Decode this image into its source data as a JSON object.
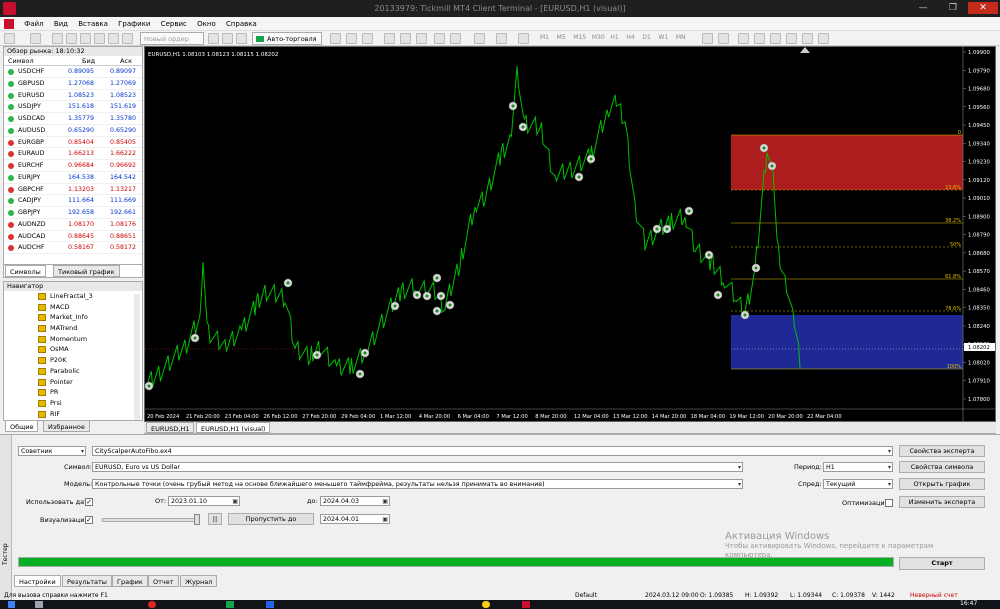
{
  "window": {
    "title": "20133979: Tickmill MT4 Client Terminal - [EURUSD,H1 (visual)]",
    "controls": [
      "—",
      "❐",
      "✕"
    ]
  },
  "menu": [
    "Файл",
    "Вид",
    "Вставка",
    "Графики",
    "Сервис",
    "Окно",
    "Справка"
  ],
  "toolbar": {
    "new_order": "Новый ордер",
    "autotrading": "Авто-торговля",
    "timeframes": [
      "M1",
      "M5",
      "M15",
      "M30",
      "H1",
      "H4",
      "D1",
      "W1",
      "MN"
    ]
  },
  "market_watch": {
    "title": "Обзор рынка: 18:10:32",
    "headers": [
      "Символ",
      "Бид",
      "Аск"
    ],
    "rows": [
      {
        "symbol": "USDCHF",
        "bid": "0.89095",
        "ask": "0.89097",
        "dir": "up"
      },
      {
        "symbol": "GBPUSD",
        "bid": "1.27068",
        "ask": "1.27069",
        "dir": "up"
      },
      {
        "symbol": "EURUSD",
        "bid": "1.08523",
        "ask": "1.08523",
        "dir": "up"
      },
      {
        "symbol": "USDJPY",
        "bid": "151.618",
        "ask": "151.619",
        "dir": "up"
      },
      {
        "symbol": "USDCAD",
        "bid": "1.35779",
        "ask": "1.35780",
        "dir": "up"
      },
      {
        "symbol": "AUDUSD",
        "bid": "0.65290",
        "ask": "0.65290",
        "dir": "up"
      },
      {
        "symbol": "EURGBP",
        "bid": "0.85404",
        "ask": "0.85405",
        "dir": "dn"
      },
      {
        "symbol": "EURAUD",
        "bid": "1.66213",
        "ask": "1.66222",
        "dir": "dn"
      },
      {
        "symbol": "EURCHF",
        "bid": "0.96684",
        "ask": "0.96692",
        "dir": "dn"
      },
      {
        "symbol": "EURJPY",
        "bid": "164.538",
        "ask": "164.542",
        "dir": "up"
      },
      {
        "symbol": "GBPCHF",
        "bid": "1.13203",
        "ask": "1.13217",
        "dir": "dn"
      },
      {
        "symbol": "CADJPY",
        "bid": "111.664",
        "ask": "111.669",
        "dir": "up"
      },
      {
        "symbol": "GBPJPY",
        "bid": "192.658",
        "ask": "192.661",
        "dir": "up"
      },
      {
        "symbol": "AUDNZD",
        "bid": "1.08170",
        "ask": "1.08176",
        "dir": "dn"
      },
      {
        "symbol": "AUDCAD",
        "bid": "0.88645",
        "ask": "0.88651",
        "dir": "dn"
      },
      {
        "symbol": "AUDCHF",
        "bid": "0.58167",
        "ask": "0.58172",
        "dir": "dn"
      }
    ],
    "tabs": [
      "Символы",
      "Тиковый график"
    ]
  },
  "navigator": {
    "title": "Навигатор",
    "items": [
      "LineFractal_3",
      "MACD",
      "Market_Info",
      "MATrend",
      "Momentum",
      "OsMA",
      "P20K",
      "Parabolic",
      "Pointer",
      "PR",
      "Prsi",
      "RIF"
    ],
    "tabs": [
      "Общие",
      "Избранное"
    ]
  },
  "chart": {
    "header": "EURUSD,H1  1.08103 1.08123 1.08115 1.08202",
    "price_labels": [
      "1.09900",
      "1.09790",
      "1.09680",
      "1.09560",
      "1.09450",
      "1.09340",
      "1.09230",
      "1.09120",
      "1.09010",
      "1.08900",
      "1.08790",
      "1.08680",
      "1.08570",
      "1.08460",
      "1.08350",
      "1.08240",
      "1.08130",
      "1.08020",
      "1.07910",
      "1.07800"
    ],
    "current_price": "1.08202",
    "time_labels": [
      "20 Feb 2024",
      "21 Feb 20:00",
      "23 Feb 04:00",
      "26 Feb 12:00",
      "27 Feb 20:00",
      "29 Feb 04:00",
      "1 Mar 12:00",
      "4 Mar 20:00",
      "6 Mar 04:00",
      "7 Mar 12:00",
      "8 Mar 20:00",
      "12 Mar 04:00",
      "13 Mar 12:00",
      "14 Mar 20:00",
      "18 Mar 04:00",
      "19 Mar 12:00",
      "20 Mar 20:00",
      "22 Mar 04:00"
    ],
    "fib_levels": [
      "0",
      "23.6%",
      "38.2%",
      "50%",
      "61.8%",
      "78.6%",
      "100%"
    ],
    "tabs": [
      "EURUSD,H1",
      "EURUSD,H1 (visual)"
    ]
  },
  "tester": {
    "type": "Советник",
    "expert": "CityScalperAutoFibo.ex4",
    "symbol_label": "Символ:",
    "symbol": "EURUSD, Euro vs US Dollar",
    "model_label": "Модель:",
    "model": "Контрольные точки (очень грубый метод на основе ближайшего меньшего таймфрейма, результаты нельзя принимать во внимание)",
    "use_date_label": "Использовать дату",
    "from_label": "От:",
    "from": "2023.01.10",
    "to_label": "до:",
    "to": "2024.04.03",
    "visual_label": "Визуализация",
    "skip_button": "Пропустить до",
    "skip_date": "2024.04.01",
    "period_label": "Период:",
    "period": "H1",
    "spread_label": "Спред:",
    "spread": "Текущий",
    "opt_label": "Оптимизация",
    "buttons": [
      "Свойства эксперта",
      "Свойства символа",
      "Открыть график",
      "Изменить эксперта"
    ],
    "start": "Старт",
    "side_label": "Тестер",
    "tabs": [
      "Настройки",
      "Результаты",
      "График",
      "Отчет",
      "Журнал"
    ]
  },
  "watermark": {
    "title": "Активация Windows",
    "text": "Чтобы активировать Windows, перейдите к параметрам компьютера."
  },
  "status": {
    "help": "Для вызова справки нажмите F1",
    "profile": "Default",
    "datetime": "2024.03.12 09:00",
    "open": "O: 1.09385",
    "high": "H: 1.09392",
    "low": "L: 1.09344",
    "close": "C: 1.09378",
    "volume": "V: 1442",
    "account": "Неверный счет"
  },
  "clock": "16:47"
}
